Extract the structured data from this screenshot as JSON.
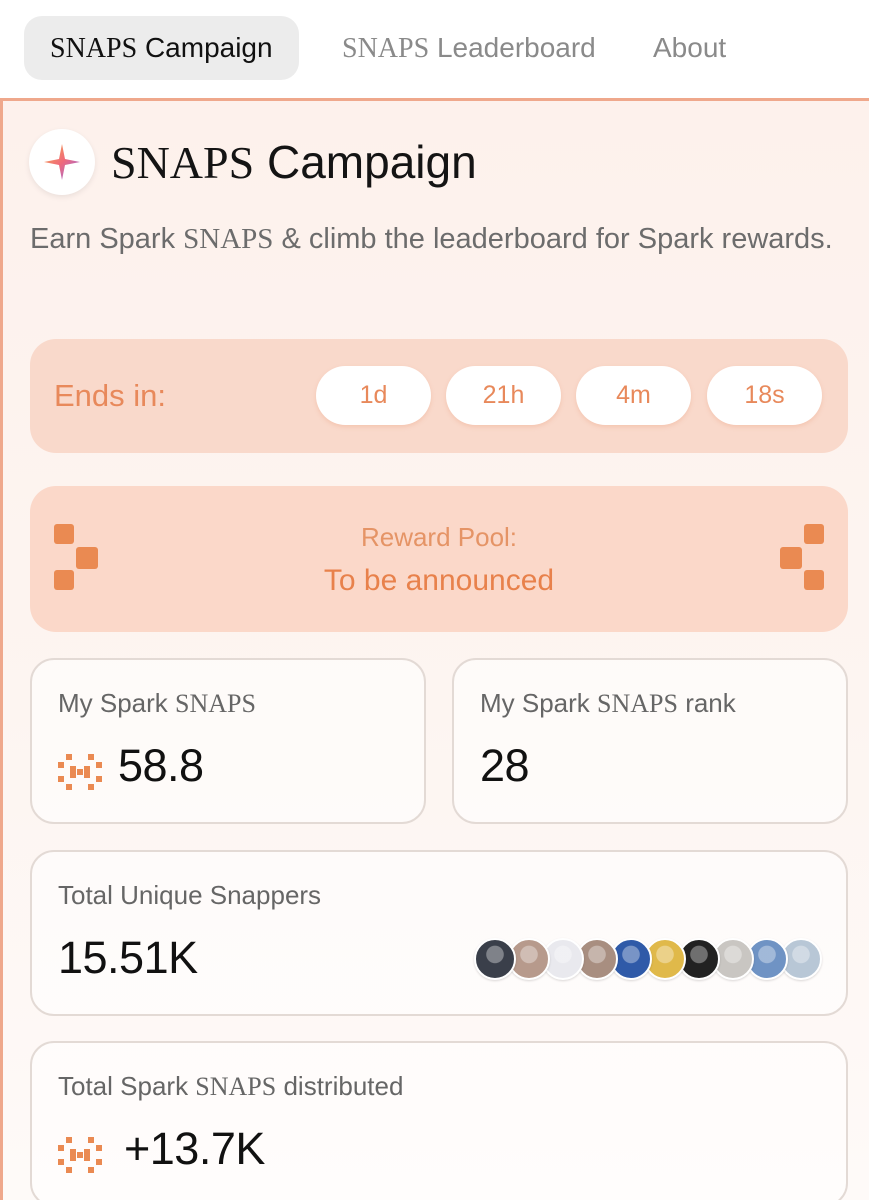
{
  "tabs": [
    {
      "prefix": "SNAPS",
      "label": "Campaign",
      "active": true
    },
    {
      "prefix": "SNAPS",
      "label": "Leaderboard",
      "active": false
    },
    {
      "prefix": "",
      "label": "About",
      "active": false
    }
  ],
  "header": {
    "logo_icon": "spark-star-icon",
    "title_prefix": "SNAPS",
    "title": "Campaign",
    "subtitle_1": "Earn Spark ",
    "subtitle_snaps": "SNAPS",
    "subtitle_2": " & climb the leaderboard for Spark rewards."
  },
  "countdown": {
    "label": "Ends in:",
    "days": "1d",
    "hours": "21h",
    "minutes": "4m",
    "seconds": "18s"
  },
  "reward": {
    "label": "Reward Pool:",
    "value": "To be announced"
  },
  "stats": {
    "my_snaps": {
      "label_1": "My Spark ",
      "label_snaps": "SNAPS",
      "value": "58.8",
      "icon": "snaps-token-icon"
    },
    "my_rank": {
      "label_1": "My Spark ",
      "label_snaps": "SNAPS",
      "label_2": " rank",
      "value": "28"
    },
    "snappers": {
      "label": "Total Unique Snappers",
      "value": "15.51K"
    },
    "distributed": {
      "label_1": "Total Spark ",
      "label_snaps": "SNAPS",
      "label_2": " distributed",
      "value": "+13.7K",
      "icon": "snaps-token-icon"
    }
  },
  "colors": {
    "accent": "#e8895b",
    "countdown_bg": "#f9d9cb",
    "reward_bg": "#fbd8c9",
    "panel_border": "#efa88c"
  },
  "avatar_colors": [
    "#3a3f4a",
    "#b79a8c",
    "#e9e9ee",
    "#a88e80",
    "#2f5aa8",
    "#e0b94a",
    "#222222",
    "#c9c6c2",
    "#6f93c4",
    "#b8c7d6"
  ]
}
